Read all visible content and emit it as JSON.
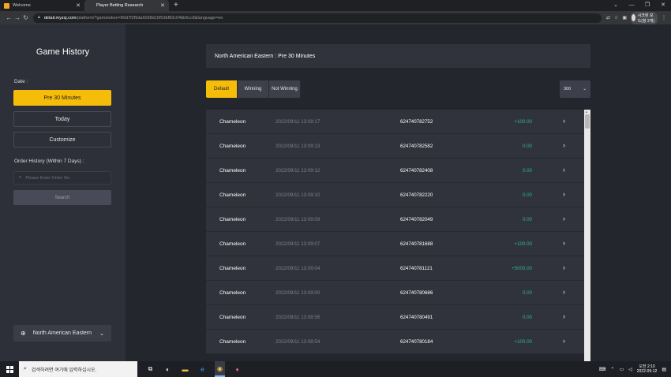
{
  "browser": {
    "tabs": [
      {
        "label": "Welcome",
        "color": "#f5a623"
      },
      {
        "label": "Player Betting Research",
        "color": "#ffffff"
      }
    ],
    "url_host": "detail.myzsj.com",
    "url_path": "/platform/?gametoken=89d7f2f9da6058d15f53bf83c04bb6cc8&language=en",
    "profile_label": "시크릿 모드(창 2개)"
  },
  "sidebar": {
    "title": "Game History",
    "date_label": "Date :",
    "date_buttons": [
      "Pre 30 Minutes",
      "Today",
      "Customize"
    ],
    "order_label": "Order History (Within 7 Days) :",
    "order_placeholder": "Please Enter Order No.",
    "search_label": "Search",
    "region_label": "North American Eastern"
  },
  "main": {
    "header": "North American Eastern : Pre 30 Minutes",
    "filters": [
      "Default",
      "Winning",
      "Not Winning"
    ],
    "count": "300",
    "rows": [
      {
        "game": "Chameleon",
        "time": "2022/09/11 13:09:17",
        "order": "624740782752",
        "amount": "+100.00"
      },
      {
        "game": "Chameleon",
        "time": "2022/09/11 13:09:13",
        "order": "624740782582",
        "amount": "0.00"
      },
      {
        "game": "Chameleon",
        "time": "2022/09/11 13:09:12",
        "order": "624740782408",
        "amount": "0.00"
      },
      {
        "game": "Chameleon",
        "time": "2022/09/11 13:09:10",
        "order": "624740782220",
        "amount": "0.00"
      },
      {
        "game": "Chameleon",
        "time": "2022/09/11 13:09:09",
        "order": "624740782049",
        "amount": "0.00"
      },
      {
        "game": "Chameleon",
        "time": "2022/09/11 13:09:07",
        "order": "624740781688",
        "amount": "+100.00"
      },
      {
        "game": "Chameleon",
        "time": "2022/09/11 13:09:04",
        "order": "624740781121",
        "amount": "+5000.00"
      },
      {
        "game": "Chameleon",
        "time": "2022/09/11 13:09:00",
        "order": "624740780686",
        "amount": "0.00"
      },
      {
        "game": "Chameleon",
        "time": "2022/09/11 13:08:56",
        "order": "624740780491",
        "amount": "0.00"
      },
      {
        "game": "Chameleon",
        "time": "2022/09/11 13:08:54",
        "order": "624740780184",
        "amount": "+100.00"
      }
    ]
  },
  "taskbar": {
    "search_placeholder": "검색하려면 여기에 입력하십시오.",
    "time": "오전 2:10",
    "date": "2022-09-12"
  },
  "colors": {
    "accent": "#f5bd0a",
    "win_amount": "#2fb38f",
    "sidebar_bg": "#2d3039",
    "main_bg": "#24262e"
  }
}
